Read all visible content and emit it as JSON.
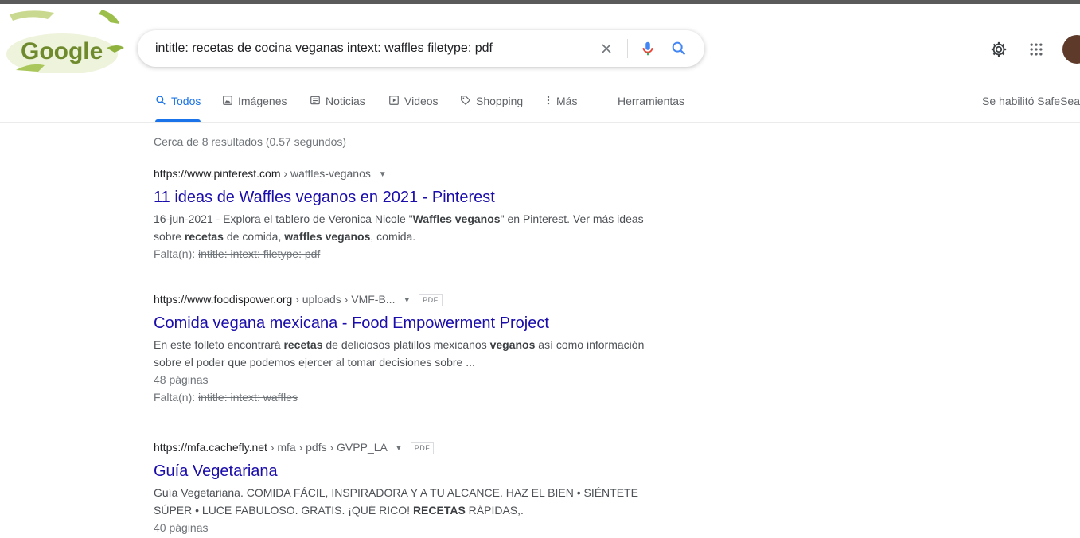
{
  "search": {
    "query": "intitle: recetas de cocina veganas intext: waffles filetype: pdf"
  },
  "logo": {
    "text": "Google"
  },
  "tabs": [
    {
      "label": "Todos",
      "active": true,
      "icon": "search-icon"
    },
    {
      "label": "Imágenes",
      "active": false,
      "icon": "image-icon"
    },
    {
      "label": "Noticias",
      "active": false,
      "icon": "news-icon"
    },
    {
      "label": "Videos",
      "active": false,
      "icon": "video-icon"
    },
    {
      "label": "Shopping",
      "active": false,
      "icon": "tag-icon"
    },
    {
      "label": "Más",
      "active": false,
      "icon": "more-vert-icon"
    },
    {
      "label": "Herramientas",
      "active": false,
      "icon": ""
    }
  ],
  "safesearch": "Se habilitó SafeSea",
  "stats": "Cerca de 8 resultados (0.57 segundos)",
  "results": [
    {
      "host": "https://www.pinterest.com",
      "crumbs": "› waffles-veganos",
      "pdf": "",
      "title": "11 ideas de Waffles veganos en 2021 - Pinterest",
      "snippet_parts": [
        {
          "t": "16-jun-2021 - Explora el tablero de Veronica Nicole \"",
          "b": false
        },
        {
          "t": "Waffles veganos",
          "b": true
        },
        {
          "t": "\" en Pinterest. Ver más ideas sobre ",
          "b": false
        },
        {
          "t": "recetas",
          "b": true
        },
        {
          "t": " de comida, ",
          "b": false
        },
        {
          "t": "waffles veganos",
          "b": true
        },
        {
          "t": ", comida.",
          "b": false
        }
      ],
      "pages": "",
      "missing_label": "Falta(n):",
      "missing_terms": "intitle: intext: filetype: pdf"
    },
    {
      "host": "https://www.foodispower.org",
      "crumbs": "› uploads › VMF-B...",
      "pdf": "PDF",
      "title": "Comida vegana mexicana - Food Empowerment Project",
      "snippet_parts": [
        {
          "t": "En este folleto encontrará ",
          "b": false
        },
        {
          "t": "recetas",
          "b": true
        },
        {
          "t": " de deliciosos platillos mexicanos ",
          "b": false
        },
        {
          "t": "veganos",
          "b": true
        },
        {
          "t": " así como información sobre el poder que podemos ejercer al tomar decisiones sobre ...",
          "b": false
        }
      ],
      "pages": "48 páginas",
      "missing_label": "Falta(n):",
      "missing_terms": "intitle: intext: waffles"
    },
    {
      "host": "https://mfa.cachefly.net",
      "crumbs": "› mfa › pdfs › GVPP_LA",
      "pdf": "PDF",
      "title": "Guía Vegetariana",
      "snippet_parts": [
        {
          "t": "Guía Vegetariana. COMIDA FÁCIL, INSPIRADORA Y A TU ALCANCE. HAZ EL BIEN • SIÉNTETE SÚPER • LUCE FABULOSO. GRATIS. ¡QUÉ RICO! ",
          "b": false
        },
        {
          "t": "RECETAS",
          "b": true
        },
        {
          "t": " RÁPIDAS,.",
          "b": false
        }
      ],
      "pages": "40 páginas",
      "missing_label": "",
      "missing_terms": ""
    }
  ],
  "colors": {
    "link": "#1a0dab",
    "accent": "#1a73e8",
    "mic_blue": "#4285f4",
    "mic_red": "#ea4335"
  }
}
